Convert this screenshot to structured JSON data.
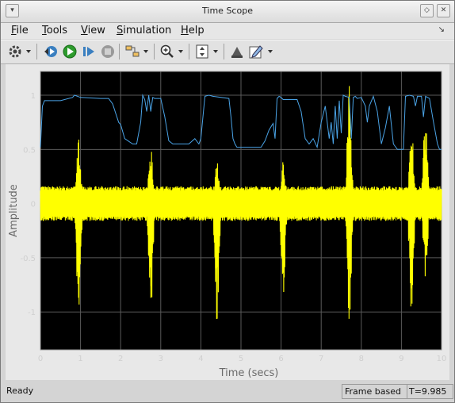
{
  "window": {
    "title": "Time Scope"
  },
  "menu": [
    "File",
    "Tools",
    "View",
    "Simulation",
    "Help"
  ],
  "toolbar": [
    "settings-icon",
    "run-step-back-icon",
    "run-icon",
    "step-forward-icon",
    "stop-icon",
    "signal-select-icon",
    "zoom-in-icon",
    "autoscale-icon",
    "highlight-icon",
    "edit-style-icon"
  ],
  "status": {
    "left": "Ready",
    "mode": "Frame based",
    "time": "T=9.985"
  },
  "colors": {
    "background": "#000000",
    "grid": "#5a5a5a",
    "series1": "#4aa3e6",
    "series2": "#ffff00",
    "axis_text": "#cfcfcf"
  },
  "chart_data": {
    "type": "line",
    "xlabel": "Time (secs)",
    "ylabel": "Amplitude",
    "xlim": [
      0,
      10
    ],
    "ylim": [
      -1.35,
      1.22
    ],
    "x_ticks": [
      "0",
      "1",
      "2",
      "3",
      "4",
      "5",
      "6",
      "7",
      "8",
      "9",
      "10"
    ],
    "y_ticks": [
      "-1",
      "-0.5",
      "0",
      "0.5",
      "1"
    ],
    "grid": true,
    "series": [
      {
        "color": "#4aa3e6",
        "x": [
          0,
          0.05,
          0.1,
          0.5,
          0.8,
          0.85,
          1.0,
          1.5,
          1.7,
          1.8,
          1.95,
          2.0,
          2.1,
          2.3,
          2.4,
          2.5,
          2.55,
          2.6,
          2.65,
          2.7,
          2.75,
          2.8,
          2.85,
          3.0,
          3.1,
          3.2,
          3.3,
          3.4,
          3.7,
          3.85,
          3.95,
          4.0,
          4.1,
          4.2,
          4.3,
          4.7,
          4.75,
          4.8,
          4.85,
          4.9,
          5.1,
          5.3,
          5.5,
          5.6,
          5.7,
          5.8,
          5.85,
          5.9,
          5.95,
          6.0,
          6.05,
          6.1,
          6.4,
          6.5,
          6.6,
          6.7,
          6.8,
          6.9,
          7.0,
          7.1,
          7.2,
          7.25,
          7.3,
          7.35,
          7.4,
          7.45,
          7.5,
          7.55,
          7.6,
          7.7,
          7.75,
          7.8,
          7.85,
          7.9,
          8.0,
          8.1,
          8.15,
          8.2,
          8.3,
          8.4,
          8.5,
          8.6,
          8.7,
          8.8,
          8.9,
          9.0,
          9.05,
          9.1,
          9.2,
          9.3,
          9.35,
          9.4,
          9.5,
          9.55,
          9.6,
          9.7,
          9.8,
          9.9,
          9.95,
          10.0
        ],
        "y": [
          0.52,
          0.9,
          0.95,
          0.95,
          0.98,
          1.0,
          0.98,
          0.97,
          0.97,
          0.92,
          0.75,
          0.73,
          0.6,
          0.55,
          0.55,
          0.75,
          1.0,
          0.96,
          0.85,
          1.0,
          0.85,
          0.98,
          0.97,
          0.97,
          0.8,
          0.58,
          0.55,
          0.55,
          0.55,
          0.6,
          0.55,
          0.6,
          0.99,
          1.0,
          0.99,
          0.97,
          0.8,
          0.6,
          0.55,
          0.52,
          0.52,
          0.52,
          0.52,
          0.58,
          0.68,
          0.74,
          0.6,
          0.97,
          0.99,
          0.98,
          0.96,
          0.96,
          0.96,
          0.85,
          0.6,
          0.55,
          0.6,
          0.52,
          0.75,
          0.9,
          0.6,
          0.75,
          0.55,
          0.9,
          0.6,
          0.95,
          0.65,
          1.0,
          0.99,
          0.98,
          0.6,
          0.98,
          0.99,
          0.97,
          0.98,
          0.9,
          0.75,
          0.9,
          0.99,
          0.85,
          0.55,
          0.7,
          0.9,
          0.55,
          0.5,
          0.5,
          0.5,
          0.99,
          1.0,
          0.99,
          0.9,
          0.99,
          0.99,
          0.8,
          0.99,
          0.97,
          0.75,
          0.55,
          0.5,
          0.5
        ]
      },
      {
        "color": "#ffff00",
        "bursts": [
          {
            "t": 0.95,
            "pos": 0.65,
            "neg": -1.1
          },
          {
            "t": 2.75,
            "pos": 0.55,
            "neg": -1.05
          },
          {
            "t": 4.4,
            "pos": 0.45,
            "neg": -1.08
          },
          {
            "t": 6.05,
            "pos": 0.45,
            "neg": -0.85
          },
          {
            "t": 7.7,
            "pos": 1.1,
            "neg": -1.1
          },
          {
            "t": 9.25,
            "pos": 0.75,
            "neg": -1.05
          },
          {
            "t": 9.6,
            "pos": 0.85,
            "neg": -0.75
          }
        ]
      }
    ]
  }
}
